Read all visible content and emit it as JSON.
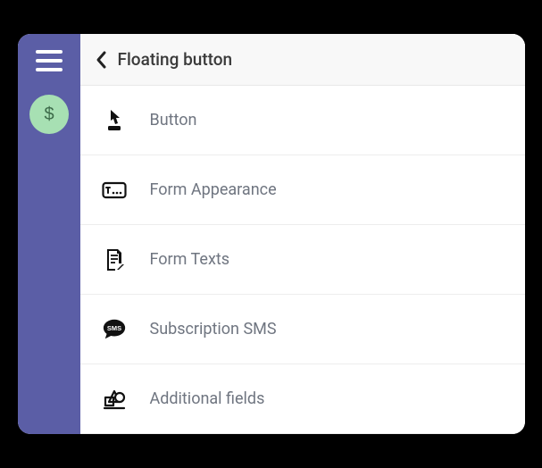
{
  "sidebar": {
    "menu_icon": "menu",
    "badge_icon": "dollar"
  },
  "header": {
    "back_icon": "chevron-left",
    "title": "Floating button"
  },
  "menu": {
    "items": [
      {
        "icon": "pointer",
        "label": "Button"
      },
      {
        "icon": "text-box",
        "label": "Form Appearance"
      },
      {
        "icon": "form-texts",
        "label": "Form Texts"
      },
      {
        "icon": "sms",
        "label": "Subscription SMS"
      },
      {
        "icon": "fields",
        "label": "Additional fields"
      }
    ]
  }
}
